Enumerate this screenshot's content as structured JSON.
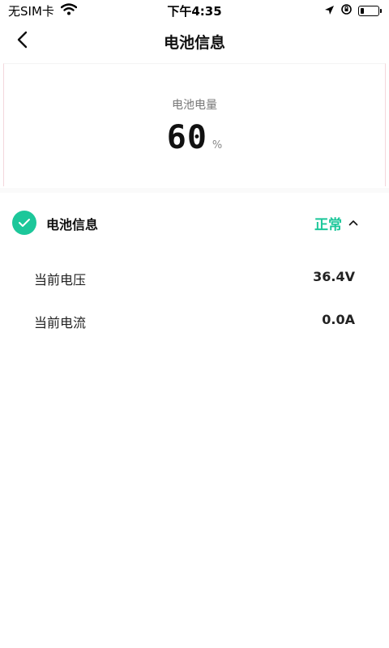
{
  "status_bar": {
    "carrier": "无SIM卡",
    "time": "下午4:35",
    "battery_level": 0.2,
    "icons": [
      "wifi-icon",
      "location-arrow-icon",
      "orientation-lock-icon",
      "battery-icon"
    ]
  },
  "nav": {
    "title": "电池信息",
    "back_icon": "chevron-left-icon"
  },
  "battery_card": {
    "label": "电池电量",
    "value": "60",
    "unit": "%"
  },
  "section": {
    "title": "电池信息",
    "status": "正常",
    "status_color": "#1cc79a",
    "icon": "check-circle-icon",
    "toggle_icon": "chevron-up-icon",
    "rows": [
      {
        "label": "当前电压",
        "value": "36.4V"
      },
      {
        "label": "当前电流",
        "value": "0.0A"
      }
    ]
  }
}
